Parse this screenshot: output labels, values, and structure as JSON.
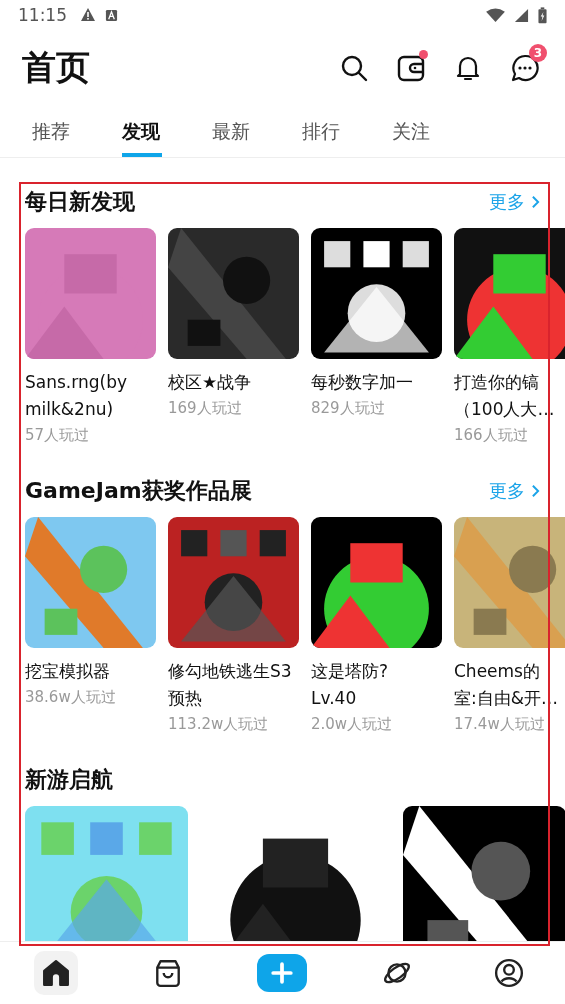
{
  "status_bar": {
    "time": "11:15"
  },
  "header": {
    "title": "首页",
    "actions": [
      {
        "kind": "search"
      },
      {
        "kind": "wallet",
        "dot": true
      },
      {
        "kind": "bell"
      },
      {
        "kind": "chat",
        "badge": "3"
      }
    ]
  },
  "tabs": [
    {
      "label": "推荐",
      "selected": false
    },
    {
      "label": "发现",
      "selected": true
    },
    {
      "label": "最新",
      "selected": false
    },
    {
      "label": "排行",
      "selected": false
    },
    {
      "label": "关注",
      "selected": false
    }
  ],
  "sections": [
    {
      "title": "每日新发现",
      "more": "更多",
      "kind": "row",
      "games": [
        {
          "kind": "picture",
          "title": "Sans.rng(by milk&2nu)",
          "plays": "57人玩过"
        },
        {
          "kind": "picture",
          "title": "校区★战争",
          "plays": "169人玩过"
        },
        {
          "kind": "picture",
          "title": "每秒数字加一",
          "plays": "829人玩过"
        },
        {
          "kind": "picture",
          "title_lines": [
            "打造你的镐",
            "（100人大…"
          ],
          "plays": "166人玩过"
        }
      ]
    },
    {
      "title": "GameJam获奖作品展",
      "more": "更多",
      "kind": "row",
      "games": [
        {
          "kind": "picture",
          "title": "挖宝模拟器",
          "plays": "38.6w人玩过"
        },
        {
          "kind": "picture",
          "title": "修勾地铁逃生S3预热",
          "plays": "113.2w人玩过"
        },
        {
          "kind": "picture",
          "title": "这是塔防?\nLv.40",
          "plays": "2.0w人玩过"
        },
        {
          "kind": "picture",
          "title_lines": [
            "Cheems的",
            "室:自由&开…"
          ],
          "plays": "17.4w人玩过"
        }
      ]
    },
    {
      "title": "新游启航",
      "kind": "wide"
    }
  ],
  "nav": [
    {
      "kind": "home",
      "selected": true
    },
    {
      "kind": "bag",
      "selected": false
    },
    {
      "kind": "plus"
    },
    {
      "kind": "planet",
      "selected": false
    },
    {
      "kind": "profile",
      "selected": false
    }
  ]
}
